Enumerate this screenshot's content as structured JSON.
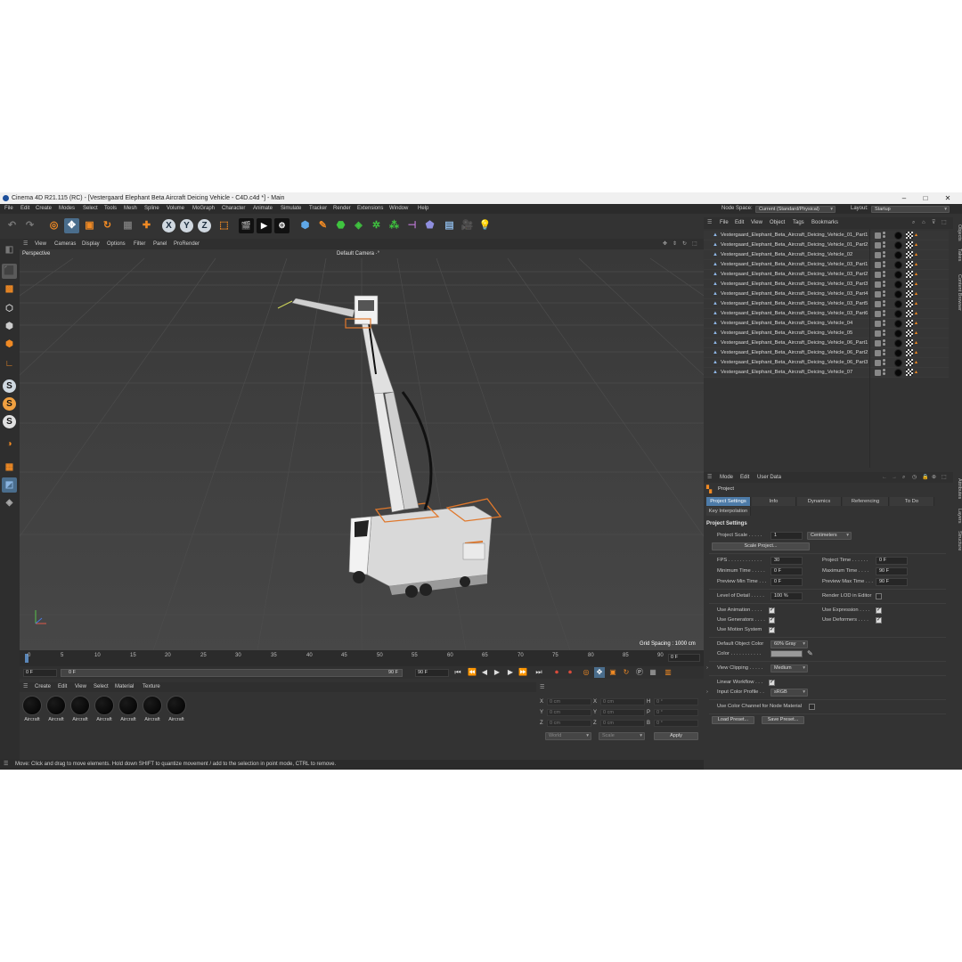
{
  "window": {
    "title": "Cinema 4D R21.115 (RC) - [Vestergaard Elephant Beta Aircraft Deicing Vehicle - C4D.c4d *] - Main",
    "min": "–",
    "max": "□",
    "close": "✕"
  },
  "menu": [
    "File",
    "Edit",
    "Create",
    "Modes",
    "Select",
    "Tools",
    "Mesh",
    "Spline",
    "Volume",
    "MoGraph",
    "Character",
    "Animate",
    "Simulate",
    "Tracker",
    "Render",
    "Extensions",
    "Window",
    "Help"
  ],
  "node_space": {
    "label": "Node Space:",
    "value": "Current (Standard/Physical)"
  },
  "layout": {
    "label": "Layout:",
    "value": "Startup"
  },
  "viewport": {
    "menu": [
      "View",
      "Cameras",
      "Display",
      "Options",
      "Filter",
      "Panel",
      "ProRender"
    ],
    "name": "Perspective",
    "camera": "Default Camera ·°",
    "grid_spacing": "Grid Spacing : 1000 cm"
  },
  "timeline": {
    "ticks": [
      "0",
      "5",
      "10",
      "15",
      "20",
      "25",
      "30",
      "35",
      "40",
      "45",
      "50",
      "55",
      "60",
      "65",
      "70",
      "75",
      "80",
      "85",
      "90"
    ],
    "current_frame": "0 F",
    "start": "0 F",
    "slider_start": "0 F",
    "slider_end": "90 F",
    "end": "90 F",
    "frame_end_field": "0 F"
  },
  "materials": {
    "menu": [
      "Create",
      "Edit",
      "View",
      "Select",
      "Material",
      "Texture"
    ],
    "items": [
      "Aircraft",
      "Aircraft",
      "Aircraft",
      "Aircraft",
      "Aircraft",
      "Aircraft",
      "Aircraft"
    ]
  },
  "coordinates": {
    "pos_labels": [
      "X",
      "Y",
      "Z"
    ],
    "size_labels": [
      "X",
      "Y",
      "Z"
    ],
    "rot_labels": [
      "H",
      "P",
      "B"
    ],
    "pos_values": [
      "0 cm",
      "0 cm",
      "0 cm"
    ],
    "size_values": [
      "0 cm",
      "0 cm",
      "0 cm"
    ],
    "rot_values": [
      "0 °",
      "0 °",
      "0 °"
    ],
    "mode": "World",
    "scale": "Scale",
    "apply": "Apply"
  },
  "status": "Move: Click and drag to move elements. Hold down SHIFT to quantize movement / add to the selection in point mode, CTRL to remove.",
  "object_manager": {
    "menu": [
      "File",
      "Edit",
      "View",
      "Object",
      "Tags",
      "Bookmarks"
    ],
    "objects": [
      "Vestergaard_Elephant_Beta_Aircraft_Deicing_Vehicle_01_Part1",
      "Vestergaard_Elephant_Beta_Aircraft_Deicing_Vehicle_01_Part2",
      "Vestergaard_Elephant_Beta_Aircraft_Deicing_Vehicle_02",
      "Vestergaard_Elephant_Beta_Aircraft_Deicing_Vehicle_03_Part1",
      "Vestergaard_Elephant_Beta_Aircraft_Deicing_Vehicle_03_Part2",
      "Vestergaard_Elephant_Beta_Aircraft_Deicing_Vehicle_03_Part3",
      "Vestergaard_Elephant_Beta_Aircraft_Deicing_Vehicle_03_Part4",
      "Vestergaard_Elephant_Beta_Aircraft_Deicing_Vehicle_03_Part5",
      "Vestergaard_Elephant_Beta_Aircraft_Deicing_Vehicle_03_Part6",
      "Vestergaard_Elephant_Beta_Aircraft_Deicing_Vehicle_04",
      "Vestergaard_Elephant_Beta_Aircraft_Deicing_Vehicle_05",
      "Vestergaard_Elephant_Beta_Aircraft_Deicing_Vehicle_06_Part1",
      "Vestergaard_Elephant_Beta_Aircraft_Deicing_Vehicle_06_Part2",
      "Vestergaard_Elephant_Beta_Aircraft_Deicing_Vehicle_06_Part3",
      "Vestergaard_Elephant_Beta_Aircraft_Deicing_Vehicle_07"
    ]
  },
  "side_tabs": [
    "Objects",
    "Takes",
    "Content Browser",
    "Attributes",
    "Layers",
    "Structure"
  ],
  "attributes": {
    "menu": [
      "Mode",
      "Edit",
      "User Data"
    ],
    "title": "Project",
    "tabs": [
      "Project Settings",
      "Info",
      "Dynamics",
      "Referencing",
      "To Do"
    ],
    "tab2": "Key Interpolation",
    "section": "Project Settings",
    "project_scale_label": "Project Scale . . . . .",
    "project_scale_value": "1",
    "project_scale_unit": "Centimeters",
    "scale_project_btn": "Scale Project...",
    "fps_label": "FPS . . . . . . . . . . . .",
    "fps": "30",
    "project_time_label": "Project Time . . . . . .",
    "project_time": "0 F",
    "min_time_label": "Minimum Time . . . . .",
    "min_time": "0 F",
    "max_time_label": "Maximum Time . . . .",
    "max_time": "90 F",
    "prev_min_label": "Preview Min Time . . .",
    "prev_min": "0 F",
    "prev_max_label": "Preview Max Time . . .",
    "prev_max": "90 F",
    "lod_label": "Level of Detail . . . . .",
    "lod": "100 %",
    "render_lod_label": "Render LOD in Editor",
    "use_anim_label": "Use Animation . . . .",
    "use_expr_label": "Use Expression . . . .",
    "use_gen_label": "Use Generators . . . .",
    "use_def_label": "Use Deformers . . . .",
    "use_motion_label": "Use Motion System",
    "def_color_label": "Default Object Color",
    "def_color": "60% Gray",
    "color_label": "Color . . . . . . . . . . .",
    "view_clip_label": "View Clipping . . . . .",
    "view_clip": "Medium",
    "linear_label": "Linear Workflow . . .",
    "input_profile_label": "Input Color Profile . .",
    "input_profile": "sRGB",
    "node_mat_label": "Use Color Channel for Node Material",
    "load_preset": "Load Preset...",
    "save_preset": "Save Preset..."
  },
  "colors": {
    "accent": "#4d7ba8",
    "orange": "#f08a24",
    "swatch": "#999999"
  }
}
